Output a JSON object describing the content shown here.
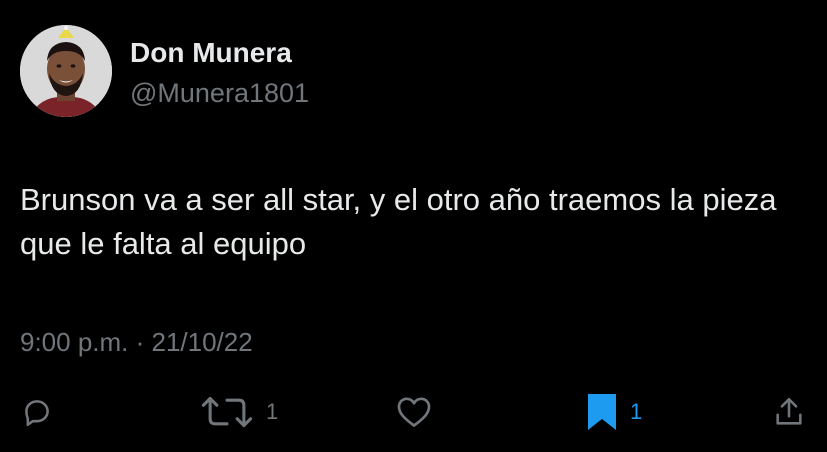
{
  "author": {
    "display_name": "Don Munera",
    "handle": "@Munera1801"
  },
  "tweet": {
    "text": "Brunson va a ser all star, y el otro año traemos la pieza que le falta al equipo",
    "timestamp": "9:00 p.m. · 21/10/22"
  },
  "actions": {
    "reply": {
      "icon": "reply-icon"
    },
    "retweet": {
      "icon": "retweet-icon",
      "count": "1"
    },
    "like": {
      "icon": "like-icon"
    },
    "bookmark": {
      "icon": "bookmark-icon",
      "count": "1",
      "active": true
    },
    "share": {
      "icon": "share-icon"
    }
  },
  "colors": {
    "background": "#000000",
    "text": "#e7e9ea",
    "secondary": "#71767b",
    "accent": "#1d9bf0"
  }
}
